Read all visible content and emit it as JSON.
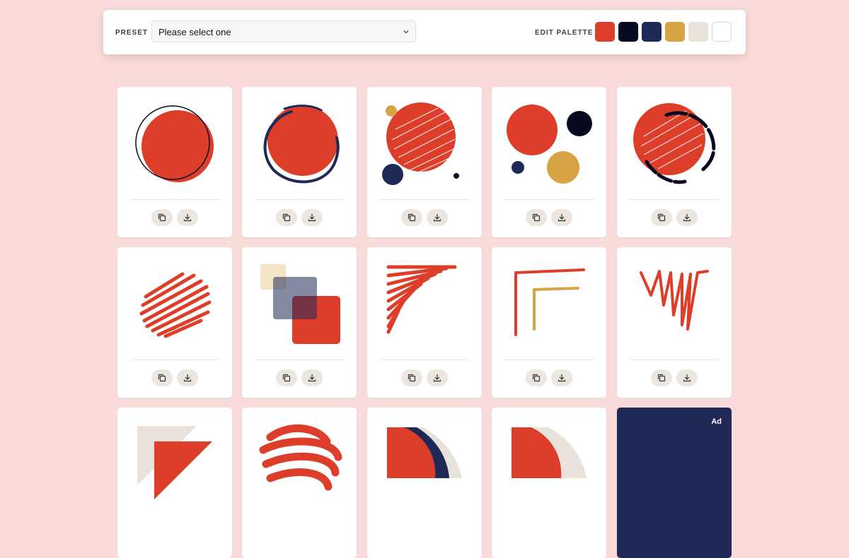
{
  "toolbar": {
    "preset_label": "PRESET",
    "preset_value": "Please select one",
    "palette_label": "EDIT PALETTE",
    "palette": [
      "#dd3e2a",
      "#070b22",
      "#1e2a55",
      "#d8a443",
      "#e8e2da",
      "#ffffff"
    ]
  },
  "grid": {
    "cards": [
      {
        "art": "circle-outline-offset"
      },
      {
        "art": "circle-ring-navy"
      },
      {
        "art": "scribble-circles"
      },
      {
        "art": "dots-composition"
      },
      {
        "art": "scribble-circle-ring"
      },
      {
        "art": "scribble-disc"
      },
      {
        "art": "overlapping-squares"
      },
      {
        "art": "scribble-triangle"
      },
      {
        "art": "scribble-corners"
      },
      {
        "art": "scribble-triangle-2"
      },
      {
        "art": "triangles"
      },
      {
        "art": "scribble-blob"
      },
      {
        "art": "quarter-arcs-navy"
      },
      {
        "art": "quarter-arcs-cream"
      }
    ],
    "ad_label": "Ad"
  }
}
